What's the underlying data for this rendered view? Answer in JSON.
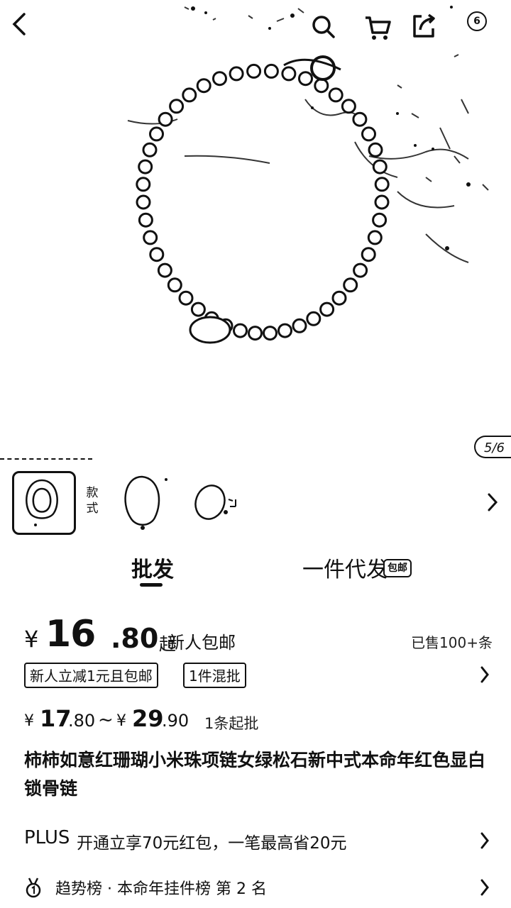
{
  "top_bar": {
    "icons": [
      "back-icon",
      "search-icon",
      "cart-icon",
      "share-icon",
      "more-icon"
    ],
    "more_badge": "6"
  },
  "gallery": {
    "counter": "5/6"
  },
  "style_selector": {
    "label": "款式",
    "selected_index": 0,
    "thumbnails": 3
  },
  "tabs": {
    "wholesale": "批发",
    "dropship": "一件代发",
    "dropship_badge": "包邮",
    "active": "wholesale"
  },
  "price": {
    "currency": "¥",
    "integer": "16",
    "decimal": ".80",
    "suffix": "起",
    "new_user_free_shipping": "新人包邮",
    "sold": "已售100+条"
  },
  "promos": [
    "新人立减1元且包邮",
    "1件混批"
  ],
  "price_range": {
    "currency": "¥",
    "low_int": "17",
    "low_dec": ".80",
    "sep": "~",
    "high_int": "29",
    "high_dec": ".90",
    "min_order": "1条起批"
  },
  "product_title": "柿柿如意红珊瑚小米珠项链女绿松石新中式本命年红色显白锁骨链",
  "plus": {
    "logo": "PLUS",
    "text": "开通立享70元红包，一笔最高省20元"
  },
  "trend": {
    "text": "趋势榜 · 本命年挂件榜  第 2 名"
  }
}
